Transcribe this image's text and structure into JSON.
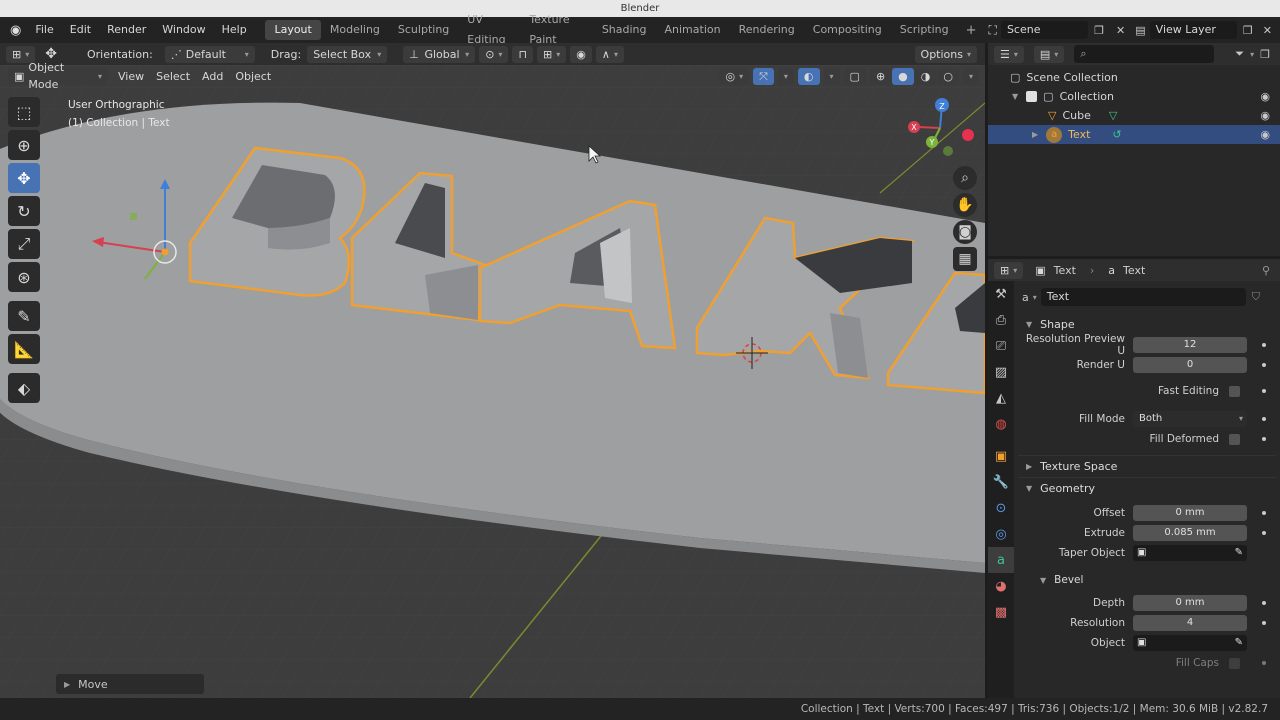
{
  "window": {
    "title": "Blender"
  },
  "menu": {
    "items": [
      "File",
      "Edit",
      "Render",
      "Window",
      "Help"
    ]
  },
  "workspaces": {
    "tabs": [
      "Layout",
      "Modeling",
      "Sculpting",
      "UV Editing",
      "Texture Paint",
      "Shading",
      "Animation",
      "Rendering",
      "Compositing",
      "Scripting"
    ],
    "active": "Layout"
  },
  "scene": {
    "name": "Scene",
    "view_layer": "View Layer"
  },
  "tool_header": {
    "orientation_label": "Orientation:",
    "orientation_value": "Default",
    "drag_label": "Drag:",
    "drag_value": "Select Box",
    "transform_space": "Global",
    "options_label": "Options"
  },
  "viewport_header": {
    "mode": "Object Mode",
    "menus": [
      "View",
      "Select",
      "Add",
      "Object"
    ]
  },
  "viewport": {
    "view_name": "User Orthographic",
    "context": "(1) Collection | Text",
    "object_text": "BLAKE",
    "move_panel": "Move",
    "axis_labels": {
      "x": "X",
      "y": "Y",
      "z": "Z"
    }
  },
  "outliner": {
    "search_placeholder": "",
    "rows": [
      {
        "label": "Scene Collection",
        "icon": "scene-collection-icon"
      },
      {
        "label": "Collection",
        "icon": "collection-icon"
      },
      {
        "label": "Cube",
        "icon": "mesh-icon"
      },
      {
        "label": "Text",
        "icon": "text-object-icon"
      }
    ]
  },
  "properties": {
    "header_object": "Text",
    "header_data": "Text",
    "datablock_name": "Text",
    "sections": {
      "shape": "Shape",
      "texture_space": "Texture Space",
      "geometry": "Geometry",
      "bevel": "Bevel"
    },
    "fields": {
      "resolution_preview_u": {
        "label": "Resolution Preview U",
        "value": "12"
      },
      "render_u": {
        "label": "Render U",
        "value": "0"
      },
      "fast_editing": {
        "label": "Fast Editing"
      },
      "fill_mode": {
        "label": "Fill Mode",
        "value": "Both"
      },
      "fill_deformed": {
        "label": "Fill Deformed"
      },
      "offset": {
        "label": "Offset",
        "value": "0 mm"
      },
      "extrude": {
        "label": "Extrude",
        "value": "0.085 mm"
      },
      "taper_object": {
        "label": "Taper Object"
      },
      "depth": {
        "label": "Depth",
        "value": "0 mm"
      },
      "resolution": {
        "label": "Resolution",
        "value": "4"
      },
      "object": {
        "label": "Object"
      },
      "fill_caps": {
        "label": "Fill Caps"
      }
    }
  },
  "status": {
    "text": "Collection | Text | Verts:700 | Faces:497 | Tris:736 | Objects:1/2 | Mem: 30.6 MiB | v2.82.7"
  },
  "colors": {
    "accent": "#4772b3",
    "selection_outline": "#f0a030",
    "selected_row": "#334d80"
  }
}
